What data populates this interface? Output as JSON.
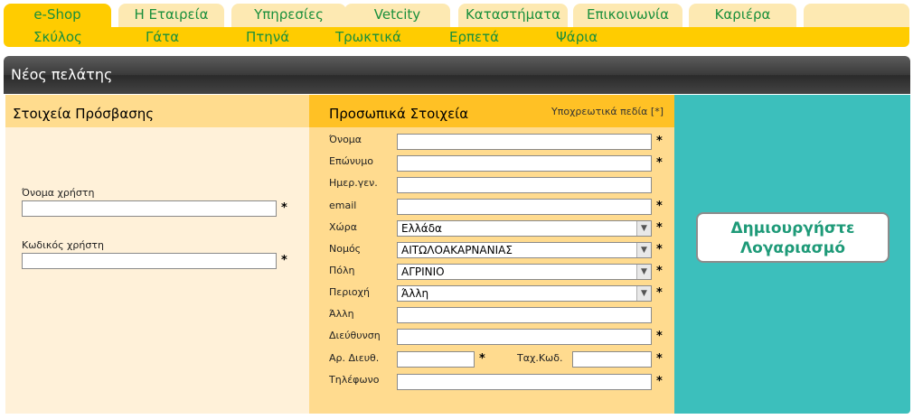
{
  "tabs": [
    "e-Shop",
    "Η Εταιρεία",
    "Υπηρεσίες",
    "Vetcity",
    "Καταστήματα",
    "Επικοινωνία",
    "Καριέρα"
  ],
  "subnav": [
    "Σκύλος",
    "Γάτα",
    "Πτηνά",
    "Τρωκτικά",
    "Ερπετά",
    "Ψάρια"
  ],
  "page_title": "Νέος πελάτης",
  "access": {
    "title": "Στοιχεία Πρόσβασης",
    "username_label": "Όνομα χρήστη",
    "password_label": "Κωδικός χρήστη"
  },
  "personal": {
    "title": "Προσωπικά Στοιχεία",
    "required_note": "Υποχρεωτικά πεδία [*]",
    "first_name_label": "Όνομα",
    "last_name_label": "Επώνυμο",
    "birthdate_label": "Ημερ.γεν.",
    "email_label": "email",
    "country_label": "Χώρα",
    "country_value": "Ελλάδα",
    "prefecture_label": "Νομός",
    "prefecture_value": "ΑΙΤΩΛΟΑΚΑΡΝΑΝΙΑΣ",
    "city_label": "Πόλη",
    "city_value": "ΑΓΡΙΝΙΟ",
    "area_label": "Περιοχή",
    "area_value": "Άλλη",
    "other_label": "Άλλη",
    "address_label": "Διεύθυνση",
    "street_no_label": "Αρ. Διευθ.",
    "postcode_label": "Ταχ.Κωδ.",
    "phone_label": "Τηλέφωνο",
    "required_mark": "*",
    "chevron_glyph": "▼"
  },
  "action": {
    "create_line1": "Δημιουργήστε",
    "create_line2": "Λογαριασμό"
  }
}
